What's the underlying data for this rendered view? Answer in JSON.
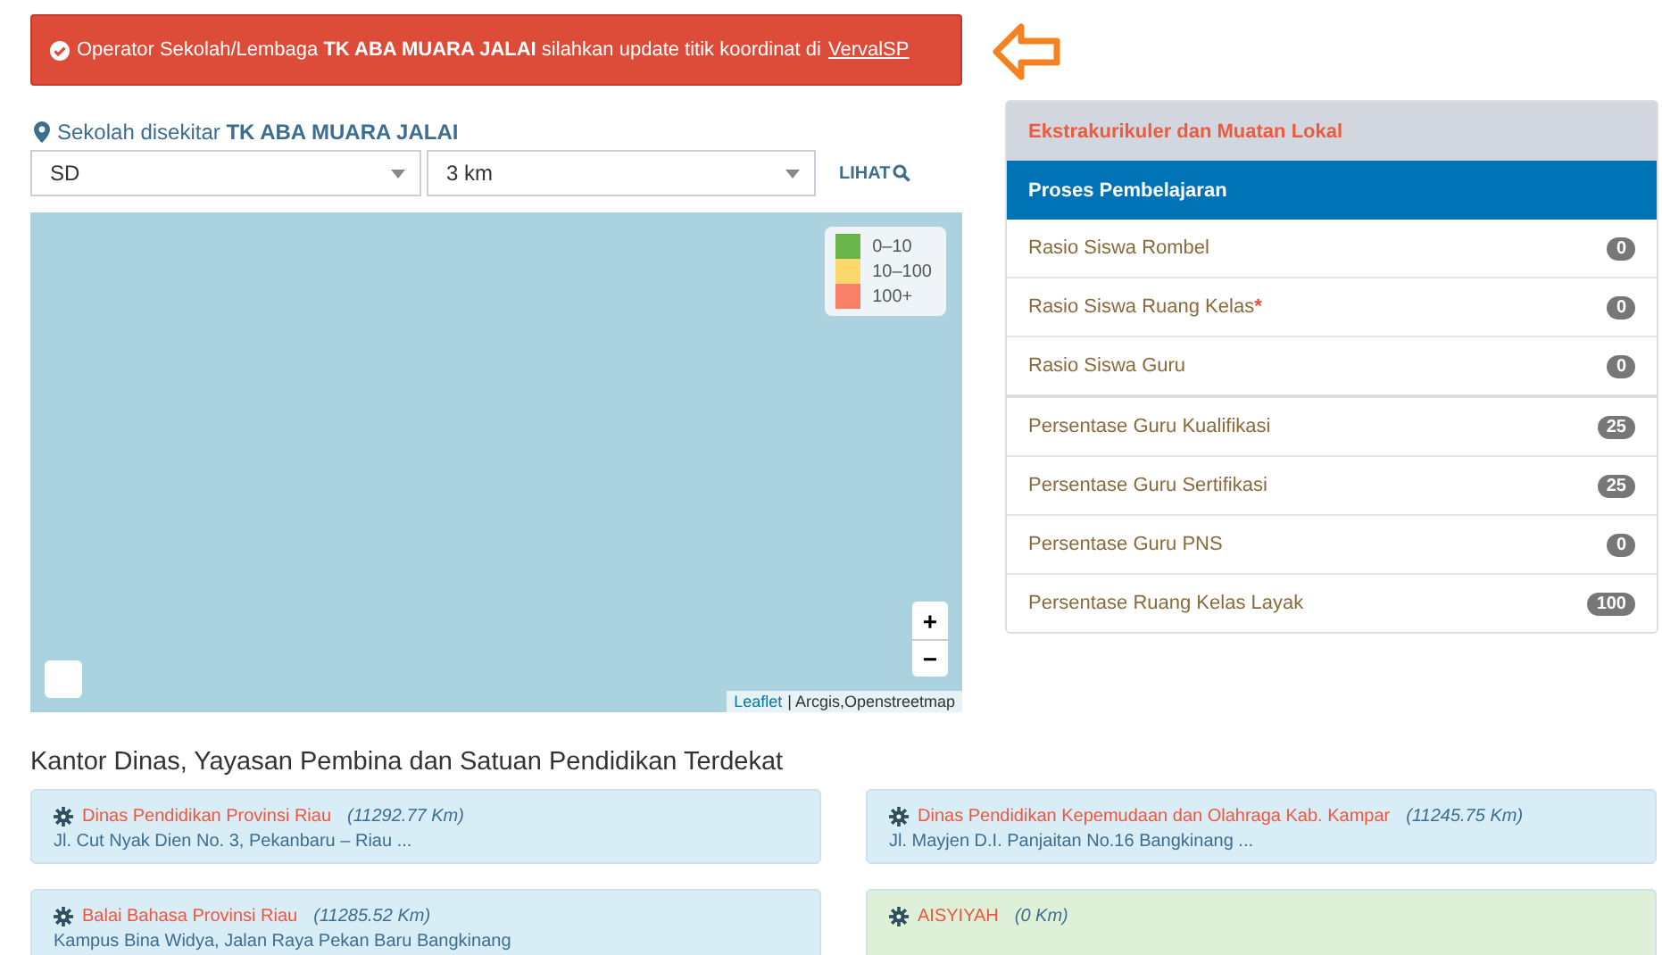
{
  "alert": {
    "text": "Operator Sekolah/Lembaga **TK ABA MUARA JALAI** silahkan update titik koordinat di",
    "link": "VervalSP"
  },
  "location": {
    "label": "Sekolah disekitar",
    "school": "TK ABA MUARA JALAI"
  },
  "filters": [
    {
      "value": "SD"
    },
    {
      "value": "3 km"
    }
  ],
  "view_button": "LIHAT",
  "map": {
    "legend": [
      {
        "label": "0–10",
        "color": "#6ab54a"
      },
      {
        "label": "10–100",
        "color": "#fbd86b"
      },
      {
        "label": "100+",
        "color": "#f98068"
      }
    ],
    "zoom_in": "+",
    "zoom_out": "−",
    "attribution_link": "Leaflet",
    "attribution": "| Arcgis,Openstreetmap"
  },
  "panel": {
    "tabs": [
      {
        "label": "Ekstrakurikuler dan Muatan Lokal",
        "selected": false
      },
      {
        "label": "Proses Pembelajaran",
        "selected": true
      }
    ],
    "groups": [
      [
        {
          "label": "Rasio Siswa Rombel",
          "badge": "0",
          "required": false
        },
        {
          "label": "Rasio Siswa Ruang Kelas",
          "badge": "0",
          "required": true
        },
        {
          "label": "Rasio Siswa Guru",
          "badge": "0",
          "required": false
        }
      ],
      [
        {
          "label": "Persentase Guru Kualifikasi",
          "badge": "25",
          "required": false
        },
        {
          "label": "Persentase Guru Sertifikasi",
          "badge": "25",
          "required": false
        },
        {
          "label": "Persentase Guru PNS",
          "badge": "0",
          "required": false
        },
        {
          "label": "Persentase Ruang Kelas Layak",
          "badge": "100",
          "required": false
        }
      ]
    ]
  },
  "required_mark": "*",
  "nearby": {
    "title": "Kantor Dinas, Yayasan Pembina dan Satuan Pendidikan Terdekat",
    "cards": [
      {
        "name": "Dinas Pendidikan Provinsi Riau",
        "distance": "(11292.77 Km)",
        "address": "Jl. Cut Nyak Dien No. 3, Pekanbaru – Riau ...",
        "color": "#d9edf7"
      },
      {
        "name": "Dinas Pendidikan Kepemudaan dan Olahraga Kab. Kampar",
        "distance": "(11245.75 Km)",
        "address": "Jl. Mayjen D.I. Panjaitan No.16 Bangkinang ...",
        "color": "#d9edf7"
      },
      {
        "name": "Balai Bahasa Provinsi Riau",
        "distance": "(11285.52 Km)",
        "address": "Kampus Bina Widya, Jalan Raya Pekan Baru Bangkinang",
        "color": "#d9edf7"
      },
      {
        "name": "AISYIYAH",
        "distance": "(0 Km)",
        "color": "#dff0d8"
      }
    ]
  }
}
